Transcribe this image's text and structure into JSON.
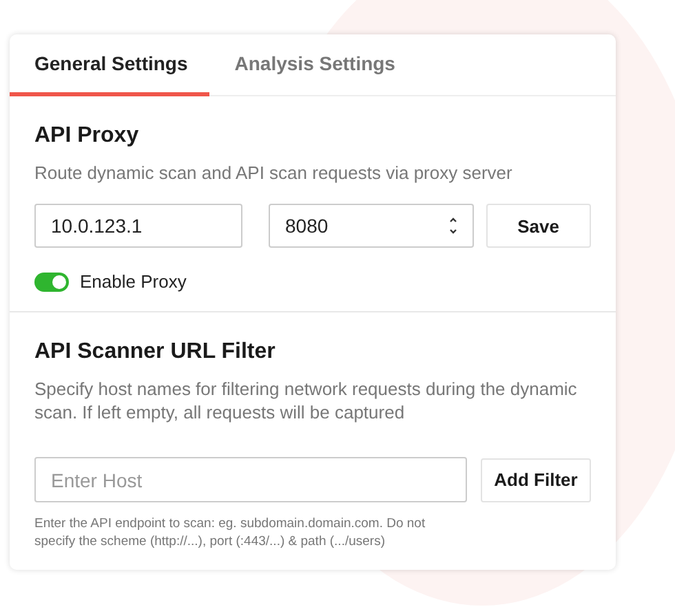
{
  "tabs": [
    {
      "label": "General Settings",
      "selected": true
    },
    {
      "label": "Analysis Settings",
      "selected": false
    }
  ],
  "api_proxy": {
    "title": "API Proxy",
    "description": "Route dynamic scan and API scan requests via proxy server",
    "host": {
      "value": "10.0.123.1"
    },
    "port": {
      "value": "8080"
    },
    "save_button": "Save",
    "enable_proxy": {
      "label": "Enable Proxy",
      "on": true
    }
  },
  "url_filter": {
    "title": "API Scanner URL Filter",
    "description": "Specify host names for filtering network requests during the dynamic scan. If left empty, all requests will be captured",
    "host": {
      "placeholder": "Enter Host"
    },
    "add_button": "Add Filter",
    "help": "Enter the API endpoint to scan: eg. subdomain.domain.com. Do not specify the scheme (http://...), port (:443/...) & path (.../users)"
  }
}
